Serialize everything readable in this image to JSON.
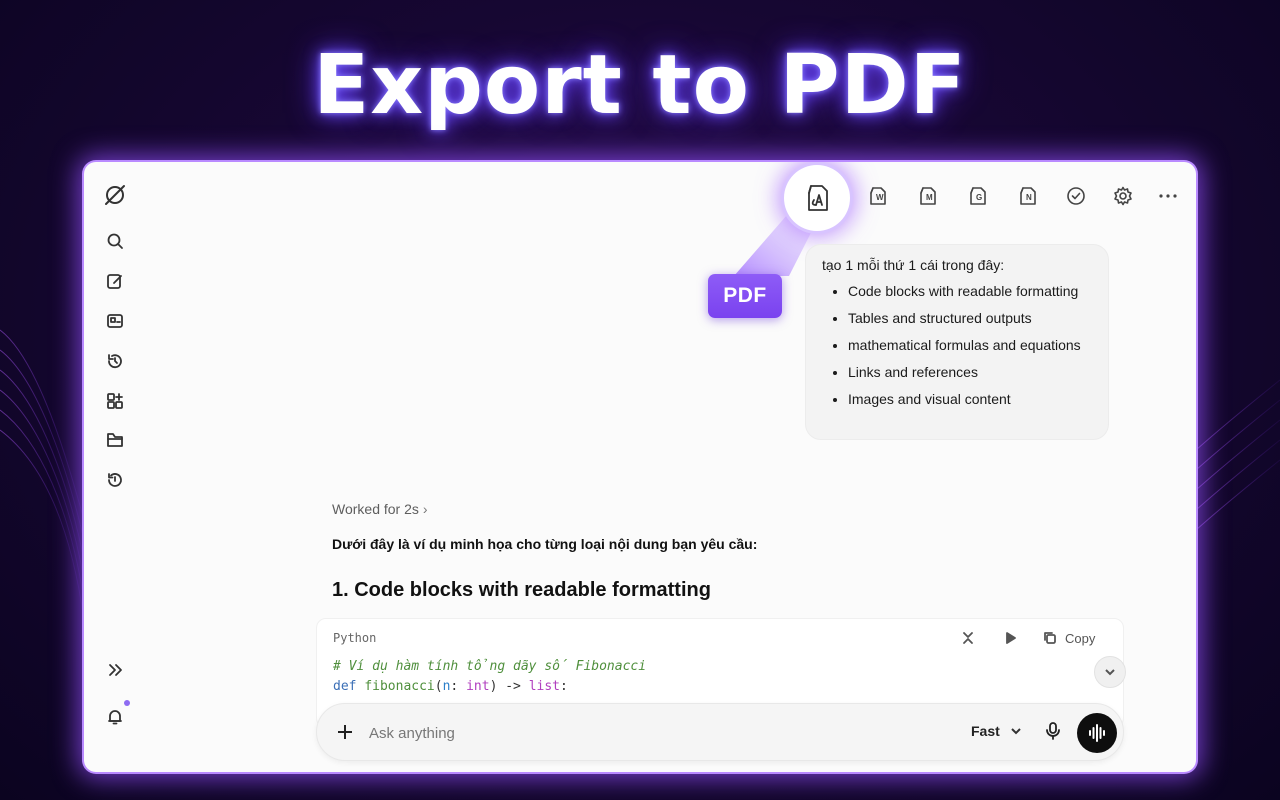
{
  "headline": "Export to PDF",
  "toolbar": {
    "pdf_badge": "PDF",
    "export_word_letter": "W",
    "export_markdown_letter": "M",
    "export_gdocs_letter": "G",
    "export_notion_letter": "N"
  },
  "user_message": {
    "lead": "tạo 1 mỗi thứ 1 cái trong đây:",
    "items": [
      "Code blocks with readable formatting",
      "Tables and structured outputs",
      "mathematical formulas and equations",
      "Links and references",
      "Images and visual content"
    ]
  },
  "assistant": {
    "worked_for": "Worked for 2s",
    "intro": "Dưới đây là ví dụ minh họa cho từng loại nội dung bạn yêu cầu:",
    "section_heading": "1. Code blocks with readable formatting"
  },
  "code_block": {
    "language": "Python",
    "copy_label": "Copy",
    "comment_line": "# Ví dụ hàm tính tổng dãy số Fibonacci",
    "line2": {
      "keyword": "def",
      "function": "fibonacci",
      "open": "(",
      "param": "n",
      "colon": ": ",
      "param_type": "int",
      "close_arrow": ") -> ",
      "return_type": "list",
      "end": ":"
    }
  },
  "composer": {
    "placeholder": "Ask anything",
    "model": "Fast"
  },
  "colors": {
    "accent": "#7a42ef",
    "glow": "#b98aff",
    "background": "#170733"
  }
}
